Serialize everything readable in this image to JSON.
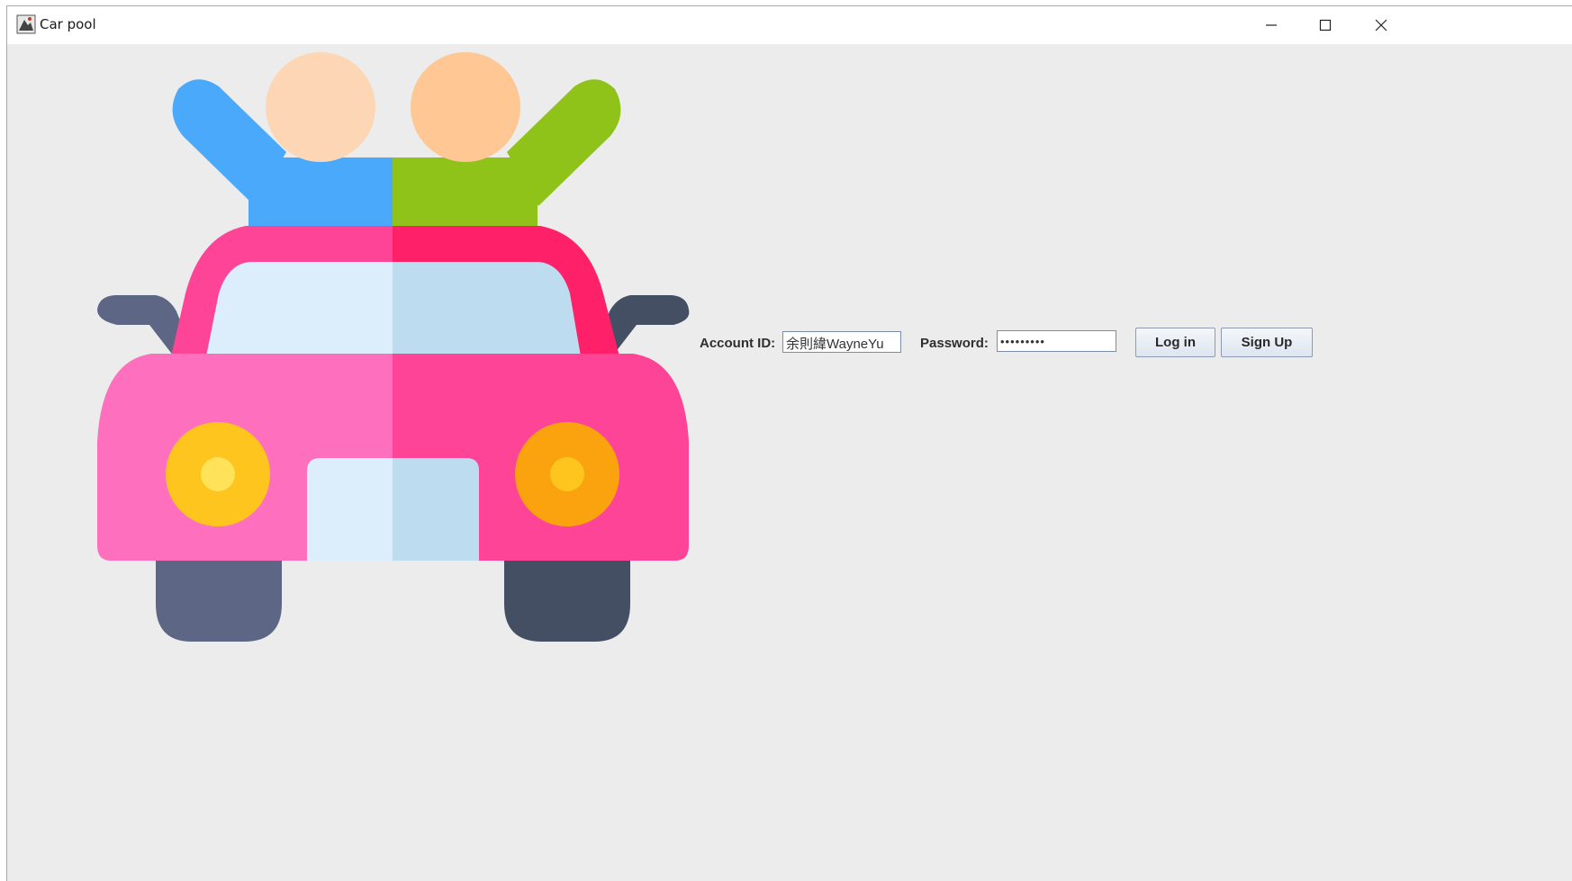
{
  "window": {
    "title": "Car pool",
    "controls": {
      "minimize": "minimize-icon",
      "maximize": "maximize-icon",
      "close": "close-icon"
    }
  },
  "illustration": {
    "icon": "carpool-car-icon",
    "colors": {
      "left_person": "#4aa9fb",
      "right_person": "#8fc31a",
      "left_head": "#fdd7b5",
      "right_head": "#fec794",
      "roof_left": "#fd4496",
      "roof_right": "#fe2169",
      "body_left": "#fe70bd",
      "body_right": "#fd4497",
      "glass_left": "#dcedfb",
      "glass_right": "#bddcef",
      "light_left": "#fec51e",
      "light_right": "#faa30f",
      "tire_left": "#5d6684",
      "tire_right": "#454f63"
    }
  },
  "login": {
    "account_label": "Account ID:",
    "account_value": "余則緯WayneYu",
    "password_label": "Password:",
    "password_value": "•••••••••",
    "login_button": "Log in",
    "signup_button": "Sign Up"
  }
}
